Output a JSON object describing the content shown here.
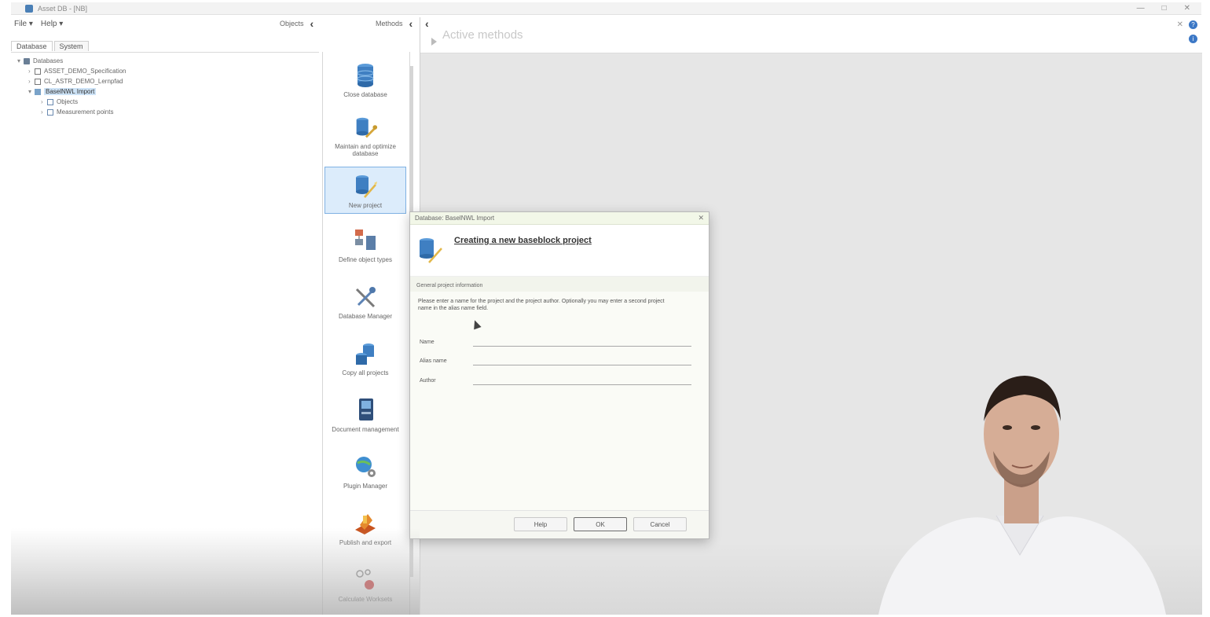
{
  "window": {
    "title": "Asset DB - [NB]",
    "controls": [
      "—",
      "□",
      "✕"
    ]
  },
  "menubar": {
    "items": [
      "File ▾",
      "Help ▾"
    ]
  },
  "panes": {
    "objects_label": "Objects",
    "methods_label": "Methods"
  },
  "tabs": [
    {
      "label": "Database",
      "active": true
    },
    {
      "label": "System",
      "active": false
    }
  ],
  "tree": {
    "items": [
      {
        "label": "Databases",
        "depth": 0,
        "expander": "▾",
        "selected": false
      },
      {
        "label": "ASSET_DEMO_Specification",
        "depth": 1,
        "expander": "›",
        "selected": false
      },
      {
        "label": "CL_ASTR_DEMO_Lernpfad",
        "depth": 1,
        "expander": "›",
        "selected": false
      },
      {
        "label": "BaselNWL Import",
        "depth": 1,
        "expander": "▾",
        "selected": true
      },
      {
        "label": "Objects",
        "depth": 2,
        "expander": "›",
        "selected": false
      },
      {
        "label": "Measurement points",
        "depth": 2,
        "expander": "›",
        "selected": false
      }
    ]
  },
  "methods": {
    "items": [
      {
        "label": "Close database",
        "icon": "database-icon",
        "selected": false
      },
      {
        "label": "Maintain and optimize database",
        "icon": "database-wrench-icon",
        "selected": false
      },
      {
        "label": "New project",
        "icon": "new-project-icon",
        "selected": true
      },
      {
        "label": "Define object types",
        "icon": "object-types-icon",
        "selected": false
      },
      {
        "label": "Database Manager",
        "icon": "tools-icon",
        "selected": false
      },
      {
        "label": "Copy all projects",
        "icon": "copy-projects-icon",
        "selected": false
      },
      {
        "label": "Document management",
        "icon": "document-management-icon",
        "selected": false
      },
      {
        "label": "Plugin Manager",
        "icon": "globe-gear-icon",
        "selected": false
      },
      {
        "label": "Publish and export",
        "icon": "publish-icon",
        "selected": false
      },
      {
        "label": "Calculate Worksets",
        "icon": "calculate-icon",
        "selected": false
      }
    ]
  },
  "content": {
    "title": "Active methods"
  },
  "dialog": {
    "title": "Database: BaselNWL Import",
    "close": "✕",
    "heading": "Creating a new baseblock project",
    "section": "General project information",
    "description": "Please enter a name for the project and the project author. Optionally you may enter a second project name in the alias name field.",
    "fields": [
      {
        "label": "Name",
        "value": ""
      },
      {
        "label": "Alias name",
        "value": ""
      },
      {
        "label": "Author",
        "value": ""
      }
    ],
    "buttons": {
      "help": "Help",
      "ok": "OK",
      "cancel": "Cancel"
    }
  },
  "colors": {
    "selection": "#cde3f7",
    "accent": "#3c78c6",
    "dialog_bg": "#fafbf6"
  }
}
